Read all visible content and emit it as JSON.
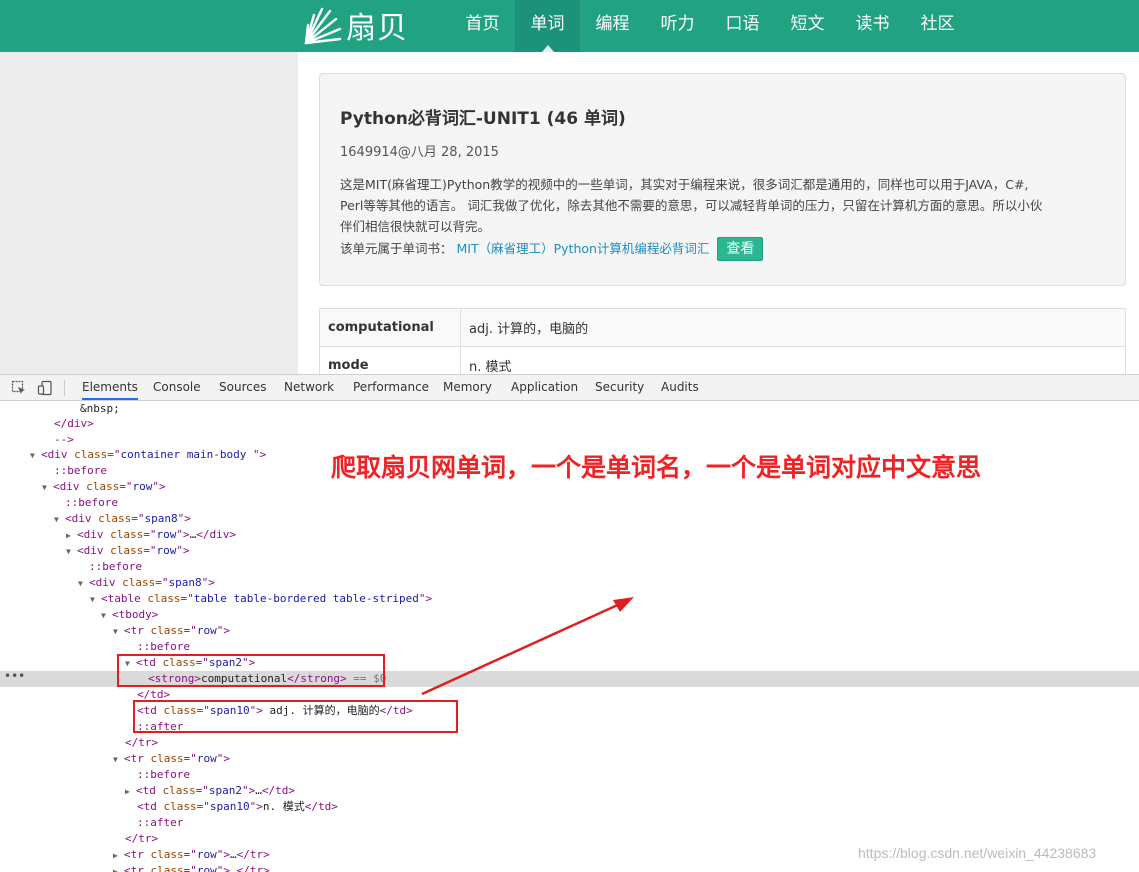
{
  "site": {
    "logo_text": "扇贝",
    "nav": [
      "首页",
      "单词",
      "编程",
      "听力",
      "口语",
      "短文",
      "读书",
      "社区"
    ],
    "active_nav": "单词"
  },
  "card": {
    "title": "Python必背词汇-UNIT1 (46 单词)",
    "meta": "1649914@八月 28, 2015",
    "desc1": "这是MIT(麻省理工)Python教学的视频中的一些单词，其实对于编程来说，很多词汇都是通用的，同样也可以用于JAVA，C#,",
    "desc2": "Perl等等其他的语言。 词汇我做了优化，除去其他不需要的意思，可以减轻背单词的压力，只留在计算机方面的意思。所以小伙",
    "desc3": "伴们相信很快就可以背完。",
    "book_label": "该单元属于单词书：",
    "book_link": "MIT（麻省理工）Python计算机编程必背词汇",
    "view_button": "查看"
  },
  "words": [
    {
      "word": "computational",
      "meaning": "adj. 计算的，电脑的"
    },
    {
      "word": "mode",
      "meaning": "n. 模式"
    }
  ],
  "devtools": {
    "tabs": [
      "Elements",
      "Console",
      "Sources",
      "Network",
      "Performance",
      "Memory",
      "Application",
      "Security",
      "Audits"
    ],
    "active_tab": "Elements",
    "lines": {
      "l0": "&nbsp;",
      "l1": "</div>",
      "l2": "-->",
      "before": "::before",
      "after": "::after",
      "td_span2_close": "</td>",
      "tr_close": "</tr>",
      "ellipsis": "…",
      "sel_suffix": " == $0",
      "strong_text": "computational",
      "td10_text1": " adj. 计算的，电脑的",
      "td10_text2": "n. 模式"
    }
  },
  "annotation": {
    "title": "爬取扇贝网单词，一个是单词名，一个是单词对应中文意思"
  },
  "watermark": "https://blog.csdn.net/weixin_44238683"
}
